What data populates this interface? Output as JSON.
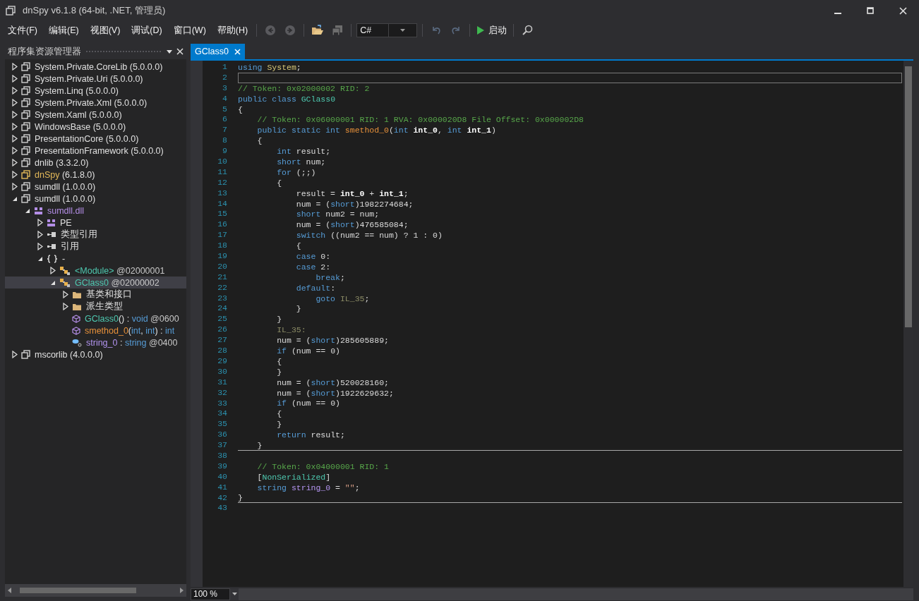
{
  "window": {
    "title": "dnSpy v6.1.8 (64-bit, .NET, 管理员)"
  },
  "menu": [
    "文件(F)",
    "编辑(E)",
    "视图(V)",
    "调试(D)",
    "窗口(W)",
    "帮助(H)"
  ],
  "toolbar": [
    {
      "kind": "back",
      "disabled": true
    },
    {
      "kind": "forward",
      "disabled": true
    },
    {
      "kind": "separator"
    },
    {
      "kind": "open",
      "disabled": false
    },
    {
      "kind": "save",
      "disabled": true
    },
    {
      "kind": "separator"
    },
    {
      "kind": "language",
      "value": "C#"
    },
    {
      "kind": "separator"
    },
    {
      "kind": "undo",
      "disabled": true
    },
    {
      "kind": "redo",
      "disabled": true
    },
    {
      "kind": "separator"
    },
    {
      "kind": "run",
      "label": "启动",
      "disabled": false
    },
    {
      "kind": "separator"
    },
    {
      "kind": "search",
      "disabled": false
    }
  ],
  "explorer": {
    "title": "程序集资源管理器",
    "tree": [
      {
        "kind": "assembly",
        "label": "System.Private.CoreLib (5.0.0.0)",
        "expanded": false,
        "selected": false
      },
      {
        "kind": "assembly",
        "label": "System.Private.Uri (5.0.0.0)",
        "expanded": false,
        "selected": false
      },
      {
        "kind": "assembly",
        "label": "System.Linq (5.0.0.0)",
        "expanded": false,
        "selected": false
      },
      {
        "kind": "assembly",
        "label": "System.Private.Xml (5.0.0.0)",
        "expanded": false,
        "selected": false
      },
      {
        "kind": "assembly",
        "label": "System.Xaml (5.0.0.0)",
        "expanded": false,
        "selected": false
      },
      {
        "kind": "assembly",
        "label": "WindowsBase (5.0.0.0)",
        "expanded": false,
        "selected": false
      },
      {
        "kind": "assembly",
        "label": "PresentationCore (5.0.0.0)",
        "expanded": false,
        "selected": false
      },
      {
        "kind": "assembly",
        "label": "PresentationFramework (5.0.0.0)",
        "expanded": false,
        "selected": false
      },
      {
        "kind": "assembly",
        "label": "dnlib (3.3.2.0)",
        "expanded": false,
        "selected": false
      },
      {
        "kind": "main-assembly",
        "parts": [
          {
            "kind": "main",
            "text": "dnSpy"
          },
          {
            "kind": "plain",
            "text": " (6.1.8.0)"
          }
        ],
        "expanded": false,
        "selected": false
      },
      {
        "kind": "assembly",
        "label": "sumdll (1.0.0.0)",
        "expanded": false,
        "selected": false
      },
      {
        "kind": "assembly",
        "label": "sumdll (1.0.0.0)",
        "expanded": true,
        "selected": false,
        "children": [
          {
            "kind": "module",
            "parts": [
              {
                "kind": "module",
                "text": "sumdll.dll"
              }
            ],
            "expanded": true,
            "selected": false,
            "children": [
              {
                "kind": "pe",
                "label": "PE",
                "expanded": false,
                "selected": false
              },
              {
                "kind": "refs",
                "label": "类型引用",
                "expanded": false,
                "selected": false
              },
              {
                "kind": "refs",
                "label": "引用",
                "expanded": false,
                "selected": false
              },
              {
                "kind": "namespace",
                "label": "-",
                "expanded": true,
                "selected": false,
                "children": [
                  {
                    "kind": "class",
                    "parts": [
                      {
                        "kind": "type",
                        "text": "<Module>"
                      },
                      {
                        "kind": "id",
                        "text": " @02000001"
                      }
                    ],
                    "expanded": false,
                    "selected": false
                  },
                  {
                    "kind": "class",
                    "parts": [
                      {
                        "kind": "type",
                        "text": "GClass0"
                      },
                      {
                        "kind": "id",
                        "text": " @02000002"
                      }
                    ],
                    "expanded": true,
                    "selected": true,
                    "children": [
                      {
                        "kind": "folder",
                        "label": "基类和接口",
                        "expanded": false,
                        "selected": false
                      },
                      {
                        "kind": "folder",
                        "label": "派生类型",
                        "expanded": false,
                        "selected": false
                      },
                      {
                        "kind": "method",
                        "parts": [
                          {
                            "kind": "type",
                            "text": "GClass0"
                          },
                          {
                            "kind": "plain",
                            "text": "() : "
                          },
                          {
                            "kind": "kw",
                            "text": "void"
                          },
                          {
                            "kind": "id",
                            "text": " @0600"
                          }
                        ],
                        "selected": false
                      },
                      {
                        "kind": "method",
                        "parts": [
                          {
                            "kind": "method",
                            "text": "smethod_0"
                          },
                          {
                            "kind": "plain",
                            "text": "("
                          },
                          {
                            "kind": "kw",
                            "text": "int"
                          },
                          {
                            "kind": "plain",
                            "text": ", "
                          },
                          {
                            "kind": "kw",
                            "text": "int"
                          },
                          {
                            "kind": "plain",
                            "text": ") : "
                          },
                          {
                            "kind": "kw",
                            "text": "int"
                          }
                        ],
                        "selected": false
                      },
                      {
                        "kind": "field",
                        "parts": [
                          {
                            "kind": "field",
                            "text": "string_0"
                          },
                          {
                            "kind": "plain",
                            "text": " : "
                          },
                          {
                            "kind": "kw",
                            "text": "string"
                          },
                          {
                            "kind": "id",
                            "text": " @0400"
                          }
                        ],
                        "selected": false
                      }
                    ]
                  }
                ]
              }
            ]
          }
        ]
      },
      {
        "kind": "assembly",
        "label": "mscorlib (4.0.0.0)",
        "expanded": false,
        "selected": false
      }
    ]
  },
  "editor": {
    "tab": {
      "label": "GClass0",
      "selected": true
    },
    "zoom": "100 %",
    "lines": [
      {
        "n": "1",
        "tokens": [
          {
            "kind": "kw",
            "text": "using "
          },
          {
            "kind": "ns",
            "text": "System"
          },
          {
            "kind": "p",
            "text": ";"
          }
        ]
      },
      {
        "n": "2",
        "current": true
      },
      {
        "n": "3",
        "tokens": [
          {
            "kind": "c",
            "text": "// Token: 0x02000002 RID: 2"
          }
        ]
      },
      {
        "n": "4",
        "tokens": [
          {
            "kind": "kw",
            "text": "public class "
          },
          {
            "kind": "type",
            "text": "GClass0"
          }
        ]
      },
      {
        "n": "5",
        "tokens": [
          {
            "kind": "p",
            "text": "{"
          }
        ]
      },
      {
        "n": "6",
        "tokens": [
          {
            "kind": "c",
            "text": "    // Token: 0x06000001 RID: 1 RVA: 0x000020D8 File Offset: 0x000002D8"
          }
        ]
      },
      {
        "n": "7",
        "tokens": [
          {
            "kind": "kw",
            "text": "    public static int "
          },
          {
            "kind": "m",
            "text": "smethod_0"
          },
          {
            "kind": "p",
            "text": "("
          },
          {
            "kind": "kw",
            "text": "int "
          },
          {
            "kind": "b",
            "text": "int_0"
          },
          {
            "kind": "p",
            "text": ", "
          },
          {
            "kind": "kw",
            "text": "int "
          },
          {
            "kind": "b",
            "text": "int_1"
          },
          {
            "kind": "p",
            "text": ")"
          }
        ]
      },
      {
        "n": "8",
        "tokens": [
          {
            "kind": "p",
            "text": "    {"
          }
        ]
      },
      {
        "n": "9",
        "tokens": [
          {
            "kind": "kw",
            "text": "        int"
          },
          {
            "kind": "p",
            "text": " result;"
          }
        ]
      },
      {
        "n": "10",
        "tokens": [
          {
            "kind": "kw",
            "text": "        short"
          },
          {
            "kind": "p",
            "text": " num;"
          }
        ]
      },
      {
        "n": "11",
        "tokens": [
          {
            "kind": "kw",
            "text": "        for"
          },
          {
            "kind": "p",
            "text": " (;;)"
          }
        ]
      },
      {
        "n": "12",
        "tokens": [
          {
            "kind": "p",
            "text": "        {"
          }
        ]
      },
      {
        "n": "13",
        "tokens": [
          {
            "kind": "p",
            "text": "            result = "
          },
          {
            "kind": "b",
            "text": "int_0"
          },
          {
            "kind": "p",
            "text": " + "
          },
          {
            "kind": "b",
            "text": "int_1"
          },
          {
            "kind": "p",
            "text": ";"
          }
        ]
      },
      {
        "n": "14",
        "tokens": [
          {
            "kind": "p",
            "text": "            num = ("
          },
          {
            "kind": "kw",
            "text": "short"
          },
          {
            "kind": "p",
            "text": ")1982274684;"
          }
        ]
      },
      {
        "n": "15",
        "tokens": [
          {
            "kind": "kw",
            "text": "            short"
          },
          {
            "kind": "p",
            "text": " num2 = num;"
          }
        ]
      },
      {
        "n": "16",
        "tokens": [
          {
            "kind": "p",
            "text": "            num = ("
          },
          {
            "kind": "kw",
            "text": "short"
          },
          {
            "kind": "p",
            "text": ")476585084;"
          }
        ]
      },
      {
        "n": "17",
        "tokens": [
          {
            "kind": "kw",
            "text": "            switch"
          },
          {
            "kind": "p",
            "text": " ((num2 == num) ? 1 : 0)"
          }
        ]
      },
      {
        "n": "18",
        "tokens": [
          {
            "kind": "p",
            "text": "            {"
          }
        ]
      },
      {
        "n": "19",
        "tokens": [
          {
            "kind": "kw",
            "text": "            case"
          },
          {
            "kind": "p",
            "text": " 0:"
          }
        ]
      },
      {
        "n": "20",
        "tokens": [
          {
            "kind": "kw",
            "text": "            case"
          },
          {
            "kind": "p",
            "text": " 2:"
          }
        ]
      },
      {
        "n": "21",
        "tokens": [
          {
            "kind": "kw",
            "text": "                break"
          },
          {
            "kind": "p",
            "text": ";"
          }
        ]
      },
      {
        "n": "22",
        "tokens": [
          {
            "kind": "kw",
            "text": "            default"
          },
          {
            "kind": "p",
            "text": ":"
          }
        ]
      },
      {
        "n": "23",
        "tokens": [
          {
            "kind": "kw",
            "text": "                goto "
          },
          {
            "kind": "l",
            "text": "IL_35"
          },
          {
            "kind": "p",
            "text": ";"
          }
        ]
      },
      {
        "n": "24",
        "tokens": [
          {
            "kind": "p",
            "text": "            }"
          }
        ]
      },
      {
        "n": "25",
        "tokens": [
          {
            "kind": "p",
            "text": "        }"
          }
        ]
      },
      {
        "n": "26",
        "tokens": [
          {
            "kind": "l",
            "text": "        IL_35:"
          }
        ]
      },
      {
        "n": "27",
        "tokens": [
          {
            "kind": "p",
            "text": "        num = ("
          },
          {
            "kind": "kw",
            "text": "short"
          },
          {
            "kind": "p",
            "text": ")285605889;"
          }
        ]
      },
      {
        "n": "28",
        "tokens": [
          {
            "kind": "kw",
            "text": "        if"
          },
          {
            "kind": "p",
            "text": " (num == 0)"
          }
        ]
      },
      {
        "n": "29",
        "tokens": [
          {
            "kind": "p",
            "text": "        {"
          }
        ]
      },
      {
        "n": "30",
        "tokens": [
          {
            "kind": "p",
            "text": "        }"
          }
        ]
      },
      {
        "n": "31",
        "tokens": [
          {
            "kind": "p",
            "text": "        num = ("
          },
          {
            "kind": "kw",
            "text": "short"
          },
          {
            "kind": "p",
            "text": ")520028160;"
          }
        ]
      },
      {
        "n": "32",
        "tokens": [
          {
            "kind": "p",
            "text": "        num = ("
          },
          {
            "kind": "kw",
            "text": "short"
          },
          {
            "kind": "p",
            "text": ")1922629632;"
          }
        ]
      },
      {
        "n": "33",
        "tokens": [
          {
            "kind": "kw",
            "text": "        if"
          },
          {
            "kind": "p",
            "text": " (num == 0)"
          }
        ]
      },
      {
        "n": "34",
        "tokens": [
          {
            "kind": "p",
            "text": "        {"
          }
        ]
      },
      {
        "n": "35",
        "tokens": [
          {
            "kind": "p",
            "text": "        }"
          }
        ]
      },
      {
        "n": "36",
        "tokens": [
          {
            "kind": "kw",
            "text": "        return"
          },
          {
            "kind": "p",
            "text": " result;"
          }
        ]
      },
      {
        "n": "37",
        "tokens": [
          {
            "kind": "p",
            "text": "    }"
          }
        ],
        "separator": true
      },
      {
        "n": "38"
      },
      {
        "n": "39",
        "tokens": [
          {
            "kind": "c",
            "text": "    // Token: 0x04000001 RID: 1"
          }
        ]
      },
      {
        "n": "40",
        "tokens": [
          {
            "kind": "p",
            "text": "    ["
          },
          {
            "kind": "type",
            "text": "NonSerialized"
          },
          {
            "kind": "p",
            "text": "]"
          }
        ]
      },
      {
        "n": "41",
        "tokens": [
          {
            "kind": "kw",
            "text": "    string "
          },
          {
            "kind": "f",
            "text": "string_0"
          },
          {
            "kind": "p",
            "text": " = "
          },
          {
            "kind": "s",
            "text": "\"\""
          },
          {
            "kind": "p",
            "text": ";"
          }
        ]
      },
      {
        "n": "42",
        "tokens": [
          {
            "kind": "p",
            "text": "}"
          }
        ],
        "separator": true
      },
      {
        "n": "43"
      }
    ]
  }
}
